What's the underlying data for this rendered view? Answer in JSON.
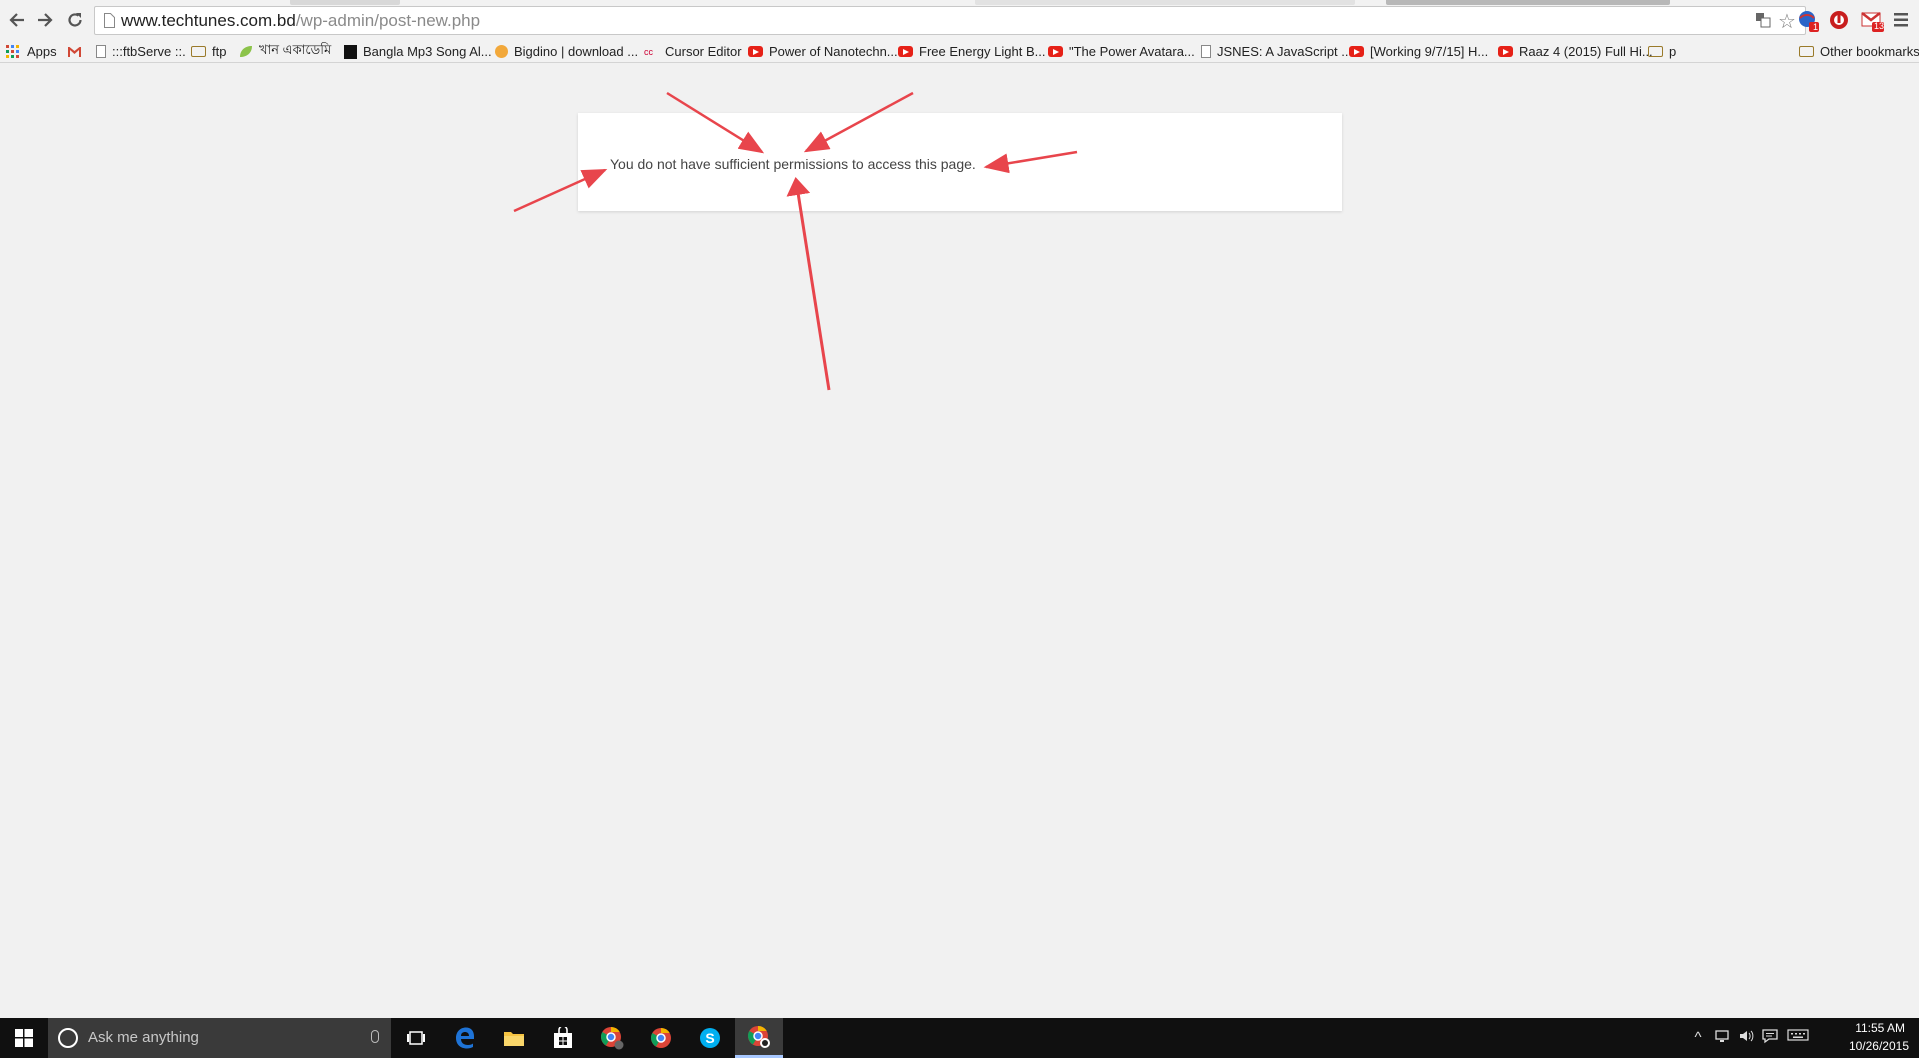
{
  "browser": {
    "url_host": "www.techtunes.com.bd",
    "url_path": "/wp-admin/post-new.php",
    "extension_badges": [
      "1",
      "13"
    ]
  },
  "bookmarks": {
    "items": [
      {
        "label": "Apps",
        "icon": "apps-grid-icon"
      },
      {
        "label": "",
        "icon": "gmail-icon"
      },
      {
        "label": ":::ftbServe ::.",
        "icon": "page-icon"
      },
      {
        "label": "ftp",
        "icon": "folder-icon"
      },
      {
        "label": "খান একাডেমি",
        "icon": "leaf-icon"
      },
      {
        "label": "Bangla Mp3 Song Al...",
        "icon": "site-icon"
      },
      {
        "label": "Bigdino | download ...",
        "icon": "site-icon"
      },
      {
        "label": "Cursor Editor",
        "icon": "site-icon"
      },
      {
        "label": "Power of Nanotechn...",
        "icon": "youtube-icon"
      },
      {
        "label": "Free Energy Light B...",
        "icon": "youtube-icon"
      },
      {
        "label": "\"The Power Avatara...",
        "icon": "youtube-icon"
      },
      {
        "label": "JSNES: A JavaScript ...",
        "icon": "page-icon"
      },
      {
        "label": "[Working 9/7/15] H...",
        "icon": "youtube-icon"
      },
      {
        "label": "Raaz 4 (2015) Full Hi...",
        "icon": "youtube-icon"
      },
      {
        "label": "p",
        "icon": "folder-icon"
      }
    ],
    "other": "Other bookmarks"
  },
  "content": {
    "message": "You do not have sufficient permissions to access this page."
  },
  "taskbar": {
    "search_placeholder": "Ask me anything",
    "apps": [
      "task-view-icon",
      "edge-icon",
      "file-explorer-icon",
      "store-icon",
      "chrome-profile-icon",
      "chrome-icon",
      "skype-icon",
      "chrome-active-icon"
    ],
    "time": "11:55 AM",
    "date": "10/26/2015"
  },
  "colors": {
    "annotation_arrow": "#e8454c",
    "page_background": "#f1f1f1"
  }
}
